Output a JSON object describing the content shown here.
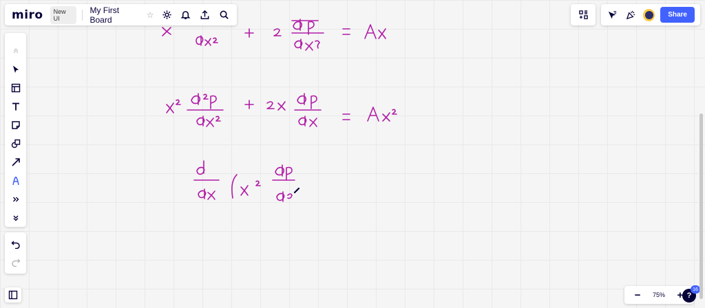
{
  "app": {
    "logo": "miro",
    "badge": "New UI",
    "board_title": "My First Board"
  },
  "top_icons": [
    "settings-icon",
    "bell-icon",
    "upload-icon",
    "search-icon"
  ],
  "right_toolbar": {
    "share_label": "Share"
  },
  "left_toolbar": [
    "collapse-icon",
    "select-icon",
    "frame-icon",
    "text-icon",
    "sticky-note-icon",
    "shapes-icon",
    "arrow-icon",
    "pen-icon",
    "more-tools-icon",
    "expand-icon"
  ],
  "history": [
    "undo-icon",
    "redo-icon"
  ],
  "zoom": {
    "level": "75%",
    "minus": "−",
    "plus": "+"
  },
  "help": {
    "label": "?",
    "count": "16"
  },
  "colors": {
    "ink": "#b01ca6",
    "accent": "#4262ff",
    "canvas": "#f5f5f5"
  }
}
